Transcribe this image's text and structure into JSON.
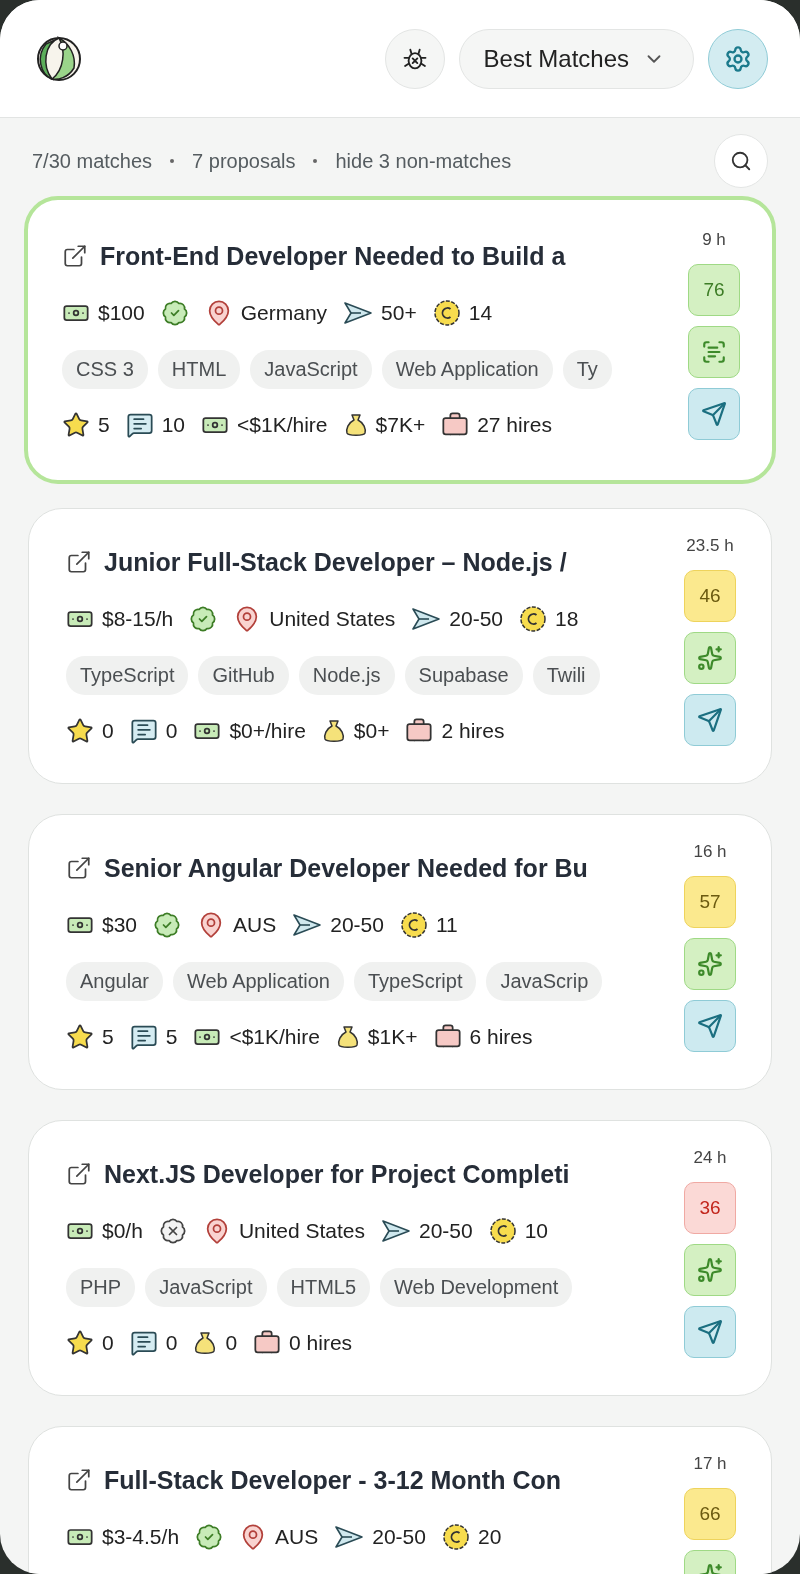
{
  "header": {
    "sort": {
      "label": "Best Matches"
    }
  },
  "summary": {
    "items": [
      "7/30 matches",
      "7 proposals",
      "hide 3 non-matches"
    ]
  },
  "jobs": [
    {
      "title": "Front-End Developer Needed to Build a",
      "selected": true,
      "age": "9 h",
      "score": {
        "text": "76",
        "kind": "high"
      },
      "action": {
        "kind": "scan"
      },
      "meta": [
        {
          "kind": "budget",
          "text": "$100"
        },
        {
          "kind": "payment",
          "verified": true
        },
        {
          "kind": "location",
          "text": "Germany"
        },
        {
          "kind": "proposals",
          "text": "50+"
        },
        {
          "kind": "connects",
          "text": "14"
        }
      ],
      "tags": [
        "CSS 3",
        "HTML",
        "JavaScript",
        "Web Application",
        "Ty"
      ],
      "stats": [
        {
          "kind": "rating",
          "text": "5"
        },
        {
          "kind": "reviews",
          "text": "10"
        },
        {
          "kind": "avg_hire",
          "text": "<$1K/hire"
        },
        {
          "kind": "spent",
          "text": "$7K+"
        },
        {
          "kind": "hires",
          "text": "27 hires"
        }
      ]
    },
    {
      "title": "Junior Full-Stack Developer – Node.js /",
      "selected": false,
      "age": "23.5 h",
      "score": {
        "text": "46",
        "kind": "medium"
      },
      "action": {
        "kind": "sparkle"
      },
      "meta": [
        {
          "kind": "budget",
          "text": "$8-15/h"
        },
        {
          "kind": "payment",
          "verified": true
        },
        {
          "kind": "location",
          "text": "United States"
        },
        {
          "kind": "proposals",
          "text": "20-50"
        },
        {
          "kind": "connects",
          "text": "18"
        }
      ],
      "tags": [
        "TypeScript",
        "GitHub",
        "Node.js",
        "Supabase",
        "Twili"
      ],
      "stats": [
        {
          "kind": "rating",
          "text": "0"
        },
        {
          "kind": "reviews",
          "text": "0"
        },
        {
          "kind": "avg_hire",
          "text": "$0+/hire"
        },
        {
          "kind": "spent",
          "text": "$0+"
        },
        {
          "kind": "hires",
          "text": "2 hires"
        }
      ]
    },
    {
      "title": "Senior Angular Developer Needed for Bu",
      "selected": false,
      "age": "16 h",
      "score": {
        "text": "57",
        "kind": "medium"
      },
      "action": {
        "kind": "sparkle"
      },
      "meta": [
        {
          "kind": "budget",
          "text": "$30"
        },
        {
          "kind": "payment",
          "verified": true
        },
        {
          "kind": "location",
          "text": "AUS"
        },
        {
          "kind": "proposals",
          "text": "20-50"
        },
        {
          "kind": "connects",
          "text": "11"
        }
      ],
      "tags": [
        "Angular",
        "Web Application",
        "TypeScript",
        "JavaScrip"
      ],
      "stats": [
        {
          "kind": "rating",
          "text": "5"
        },
        {
          "kind": "reviews",
          "text": "5"
        },
        {
          "kind": "avg_hire",
          "text": "<$1K/hire"
        },
        {
          "kind": "spent",
          "text": "$1K+"
        },
        {
          "kind": "hires",
          "text": "6 hires"
        }
      ]
    },
    {
      "title": "Next.JS Developer for Project Completi",
      "selected": false,
      "age": "24 h",
      "score": {
        "text": "36",
        "kind": "low"
      },
      "action": {
        "kind": "sparkle"
      },
      "meta": [
        {
          "kind": "budget",
          "text": "$0/h"
        },
        {
          "kind": "payment",
          "verified": false
        },
        {
          "kind": "location",
          "text": "United States"
        },
        {
          "kind": "proposals",
          "text": "20-50"
        },
        {
          "kind": "connects",
          "text": "10"
        }
      ],
      "tags": [
        "PHP",
        "JavaScript",
        "HTML5",
        "Web Development"
      ],
      "stats": [
        {
          "kind": "rating",
          "text": "0"
        },
        {
          "kind": "reviews",
          "text": "0"
        },
        {
          "kind": "spent",
          "text": "0"
        },
        {
          "kind": "hires",
          "text": "0 hires"
        }
      ]
    },
    {
      "title": "Full-Stack Developer - 3-12 Month Con",
      "selected": false,
      "age": "17 h",
      "score": {
        "text": "66",
        "kind": "medium"
      },
      "action": {
        "kind": "sparkle"
      },
      "meta": [
        {
          "kind": "budget",
          "text": "$3-4.5/h"
        },
        {
          "kind": "payment",
          "verified": true
        },
        {
          "kind": "location",
          "text": "AUS"
        },
        {
          "kind": "proposals",
          "text": "20-50"
        },
        {
          "kind": "connects",
          "text": "20"
        }
      ]
    }
  ]
}
